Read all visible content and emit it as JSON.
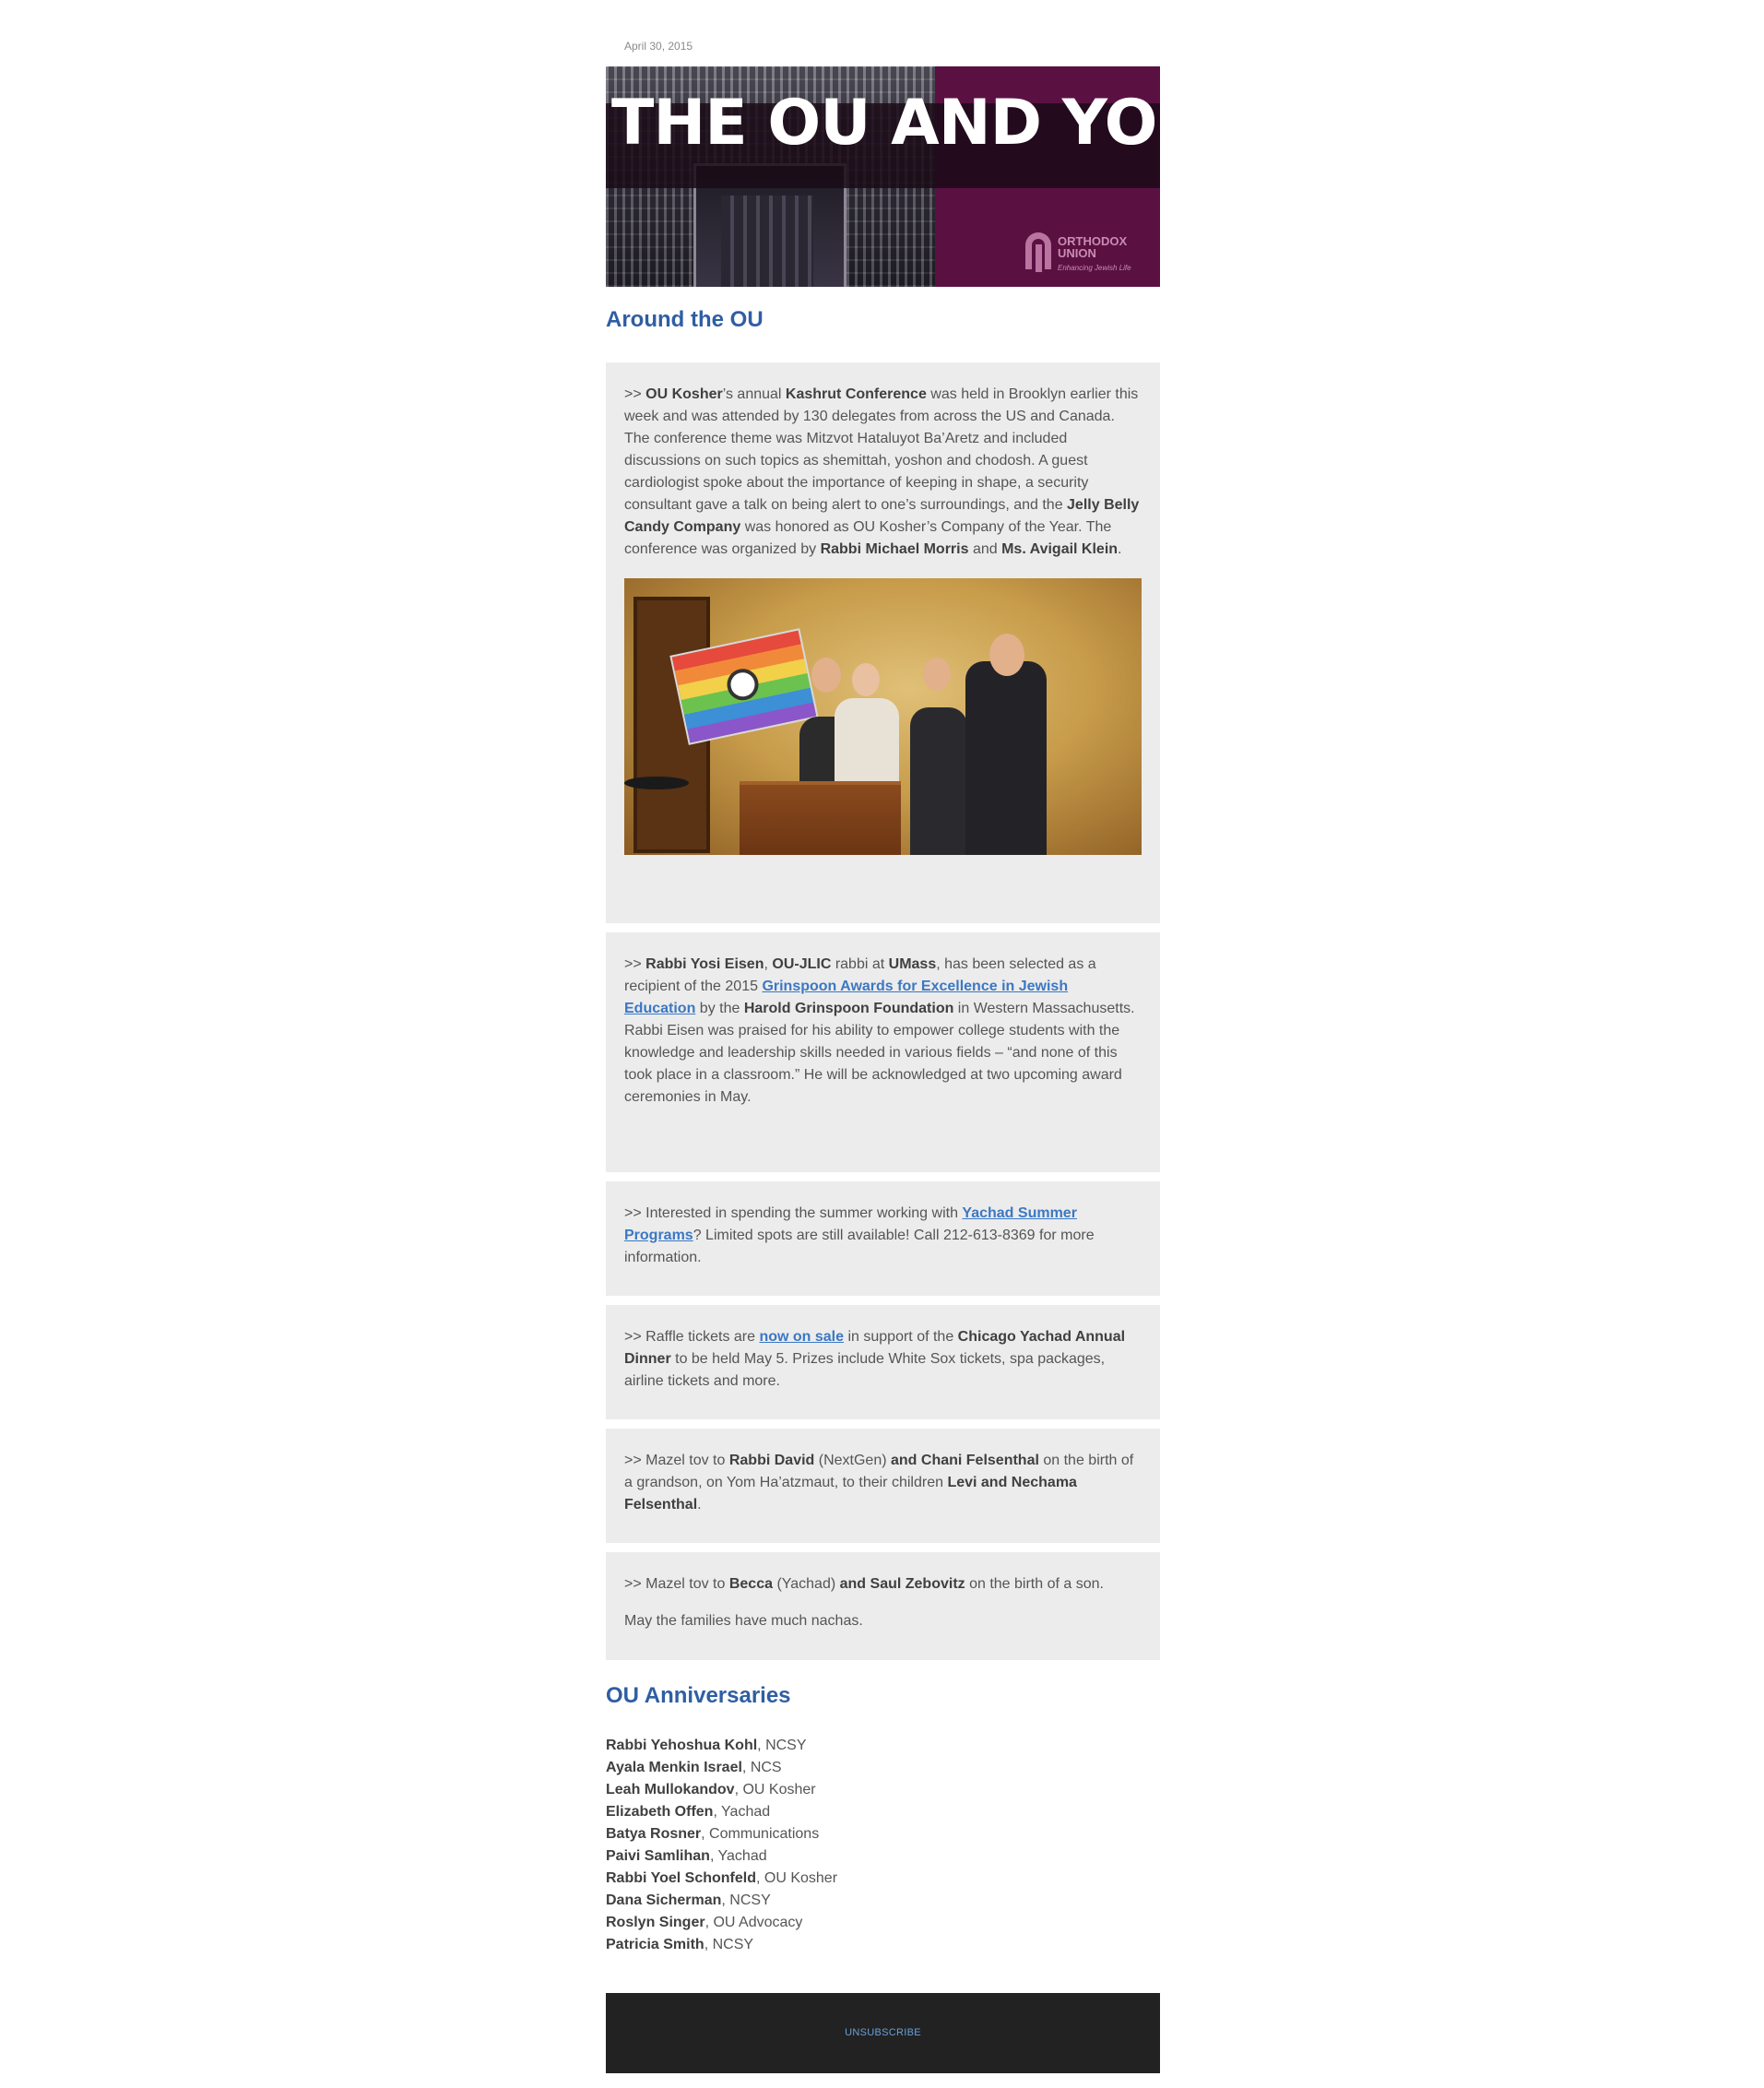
{
  "header": {
    "date": "April 30, 2015"
  },
  "banner": {
    "title": "THE OU AND YOU",
    "logo_line1": "ORTHODOX",
    "logo_line2": "UNION",
    "logo_tagline": "Enhancing Jewish Life"
  },
  "section1": {
    "heading": "Around the OU"
  },
  "items": {
    "kashrut": {
      "prefix": ">> ",
      "b1": "OU Kosher",
      "t1": "’s annual ",
      "b2": "Kashrut Conference",
      "t2": " was held in Brooklyn earlier this week and was attended by 130 delegates from across the US and Canada. The conference theme was Mitzvot Hataluyot Ba’Aretz and included discussions on such topics as shemittah, yoshon and chodosh. A guest cardiologist spoke about the importance of keeping in shape, a security consultant gave a talk on being alert to one’s surroundings, and the ",
      "b3": "Jelly Belly Candy Company",
      "t3": " was honored as OU Kosher’s Company of the Year. The conference was organized by ",
      "b4": "Rabbi Michael Morris",
      "t4": " and ",
      "b5": "Ms. Avigail Klein",
      "t5": "."
    },
    "eisen": {
      "prefix": ">> ",
      "b1": "Rabbi Yosi Eisen",
      "t1": ", ",
      "b2": "OU-JLIC",
      "t2": " rabbi at ",
      "b3": "UMass",
      "t3": ", has been selected as a recipient of the 2015 ",
      "link": "Grinspoon Awards for Excellence in Jewish Education",
      "t4": " by the ",
      "b4": "Harold Grinspoon Foundation",
      "t5": " in Western Massachusetts. Rabbi Eisen was praised for his ability to empower college students with the knowledge and leadership skills needed in various fields – “and none of this took place in a classroom.” He will be acknowledged at two upcoming award ceremonies in May."
    },
    "yachad": {
      "prefix": ">> ",
      "t1": "Interested in spending the summer working with ",
      "link": "Yachad Summer Programs",
      "t2": "? Limited spots are still available! Call 212-613-8369 for more information."
    },
    "raffle": {
      "prefix": ">> ",
      "t1": "Raffle tickets are ",
      "link": "now on sale",
      "t2": " in support of the ",
      "b1": "Chicago Yachad Annual Dinner",
      "t3": " to be held May 5. Prizes include White Sox tickets, spa packages, airline tickets and more."
    },
    "felsenthal": {
      "prefix": ">> ",
      "t1": "Mazel tov to ",
      "b1": "Rabbi David",
      "t2": " (NextGen) ",
      "b2": "and Chani Felsenthal",
      "t3": " on the birth of a grandson, on Yom Ha’atzmaut, to their children ",
      "b3": "Levi and Nechama Felsenthal",
      "t4": "."
    },
    "zebovitz": {
      "prefix": ">> ",
      "t1": "Mazel tov to ",
      "b1": "Becca",
      "t2": " (Yachad) ",
      "b2": "and Saul Zebovitz",
      "t3": " on the birth of a son.",
      "closing": "May the families have much nachas."
    }
  },
  "section2": {
    "heading": "OU Anniversaries",
    "people": [
      {
        "name": "Rabbi Yehoshua Kohl",
        "dept": ", NCSY"
      },
      {
        "name": "Ayala Menkin Israel",
        "dept": ", NCS"
      },
      {
        "name": "Leah Mullokandov",
        "dept": ", OU Kosher"
      },
      {
        "name": "Elizabeth Offen",
        "dept": ", Yachad"
      },
      {
        "name": "Batya Rosner",
        "dept": ", Communications"
      },
      {
        "name": "Paivi Samlihan",
        "dept": ", Yachad"
      },
      {
        "name": "Rabbi Yoel Schonfeld",
        "dept": ", OU Kosher"
      },
      {
        "name": "Dana Sicherman",
        "dept": ", NCSY"
      },
      {
        "name": "Roslyn Singer",
        "dept": ", OU Advocacy"
      },
      {
        "name": "Patricia Smith",
        "dept": ", NCSY"
      }
    ]
  },
  "footer": {
    "unsubscribe": "UNSUBSCRIBE"
  },
  "colors": {
    "heading": "#2f5ea3",
    "link": "#3b78c4",
    "box_bg": "#ececec",
    "banner_bg": "#5a1142",
    "footer_bg": "#222222"
  }
}
